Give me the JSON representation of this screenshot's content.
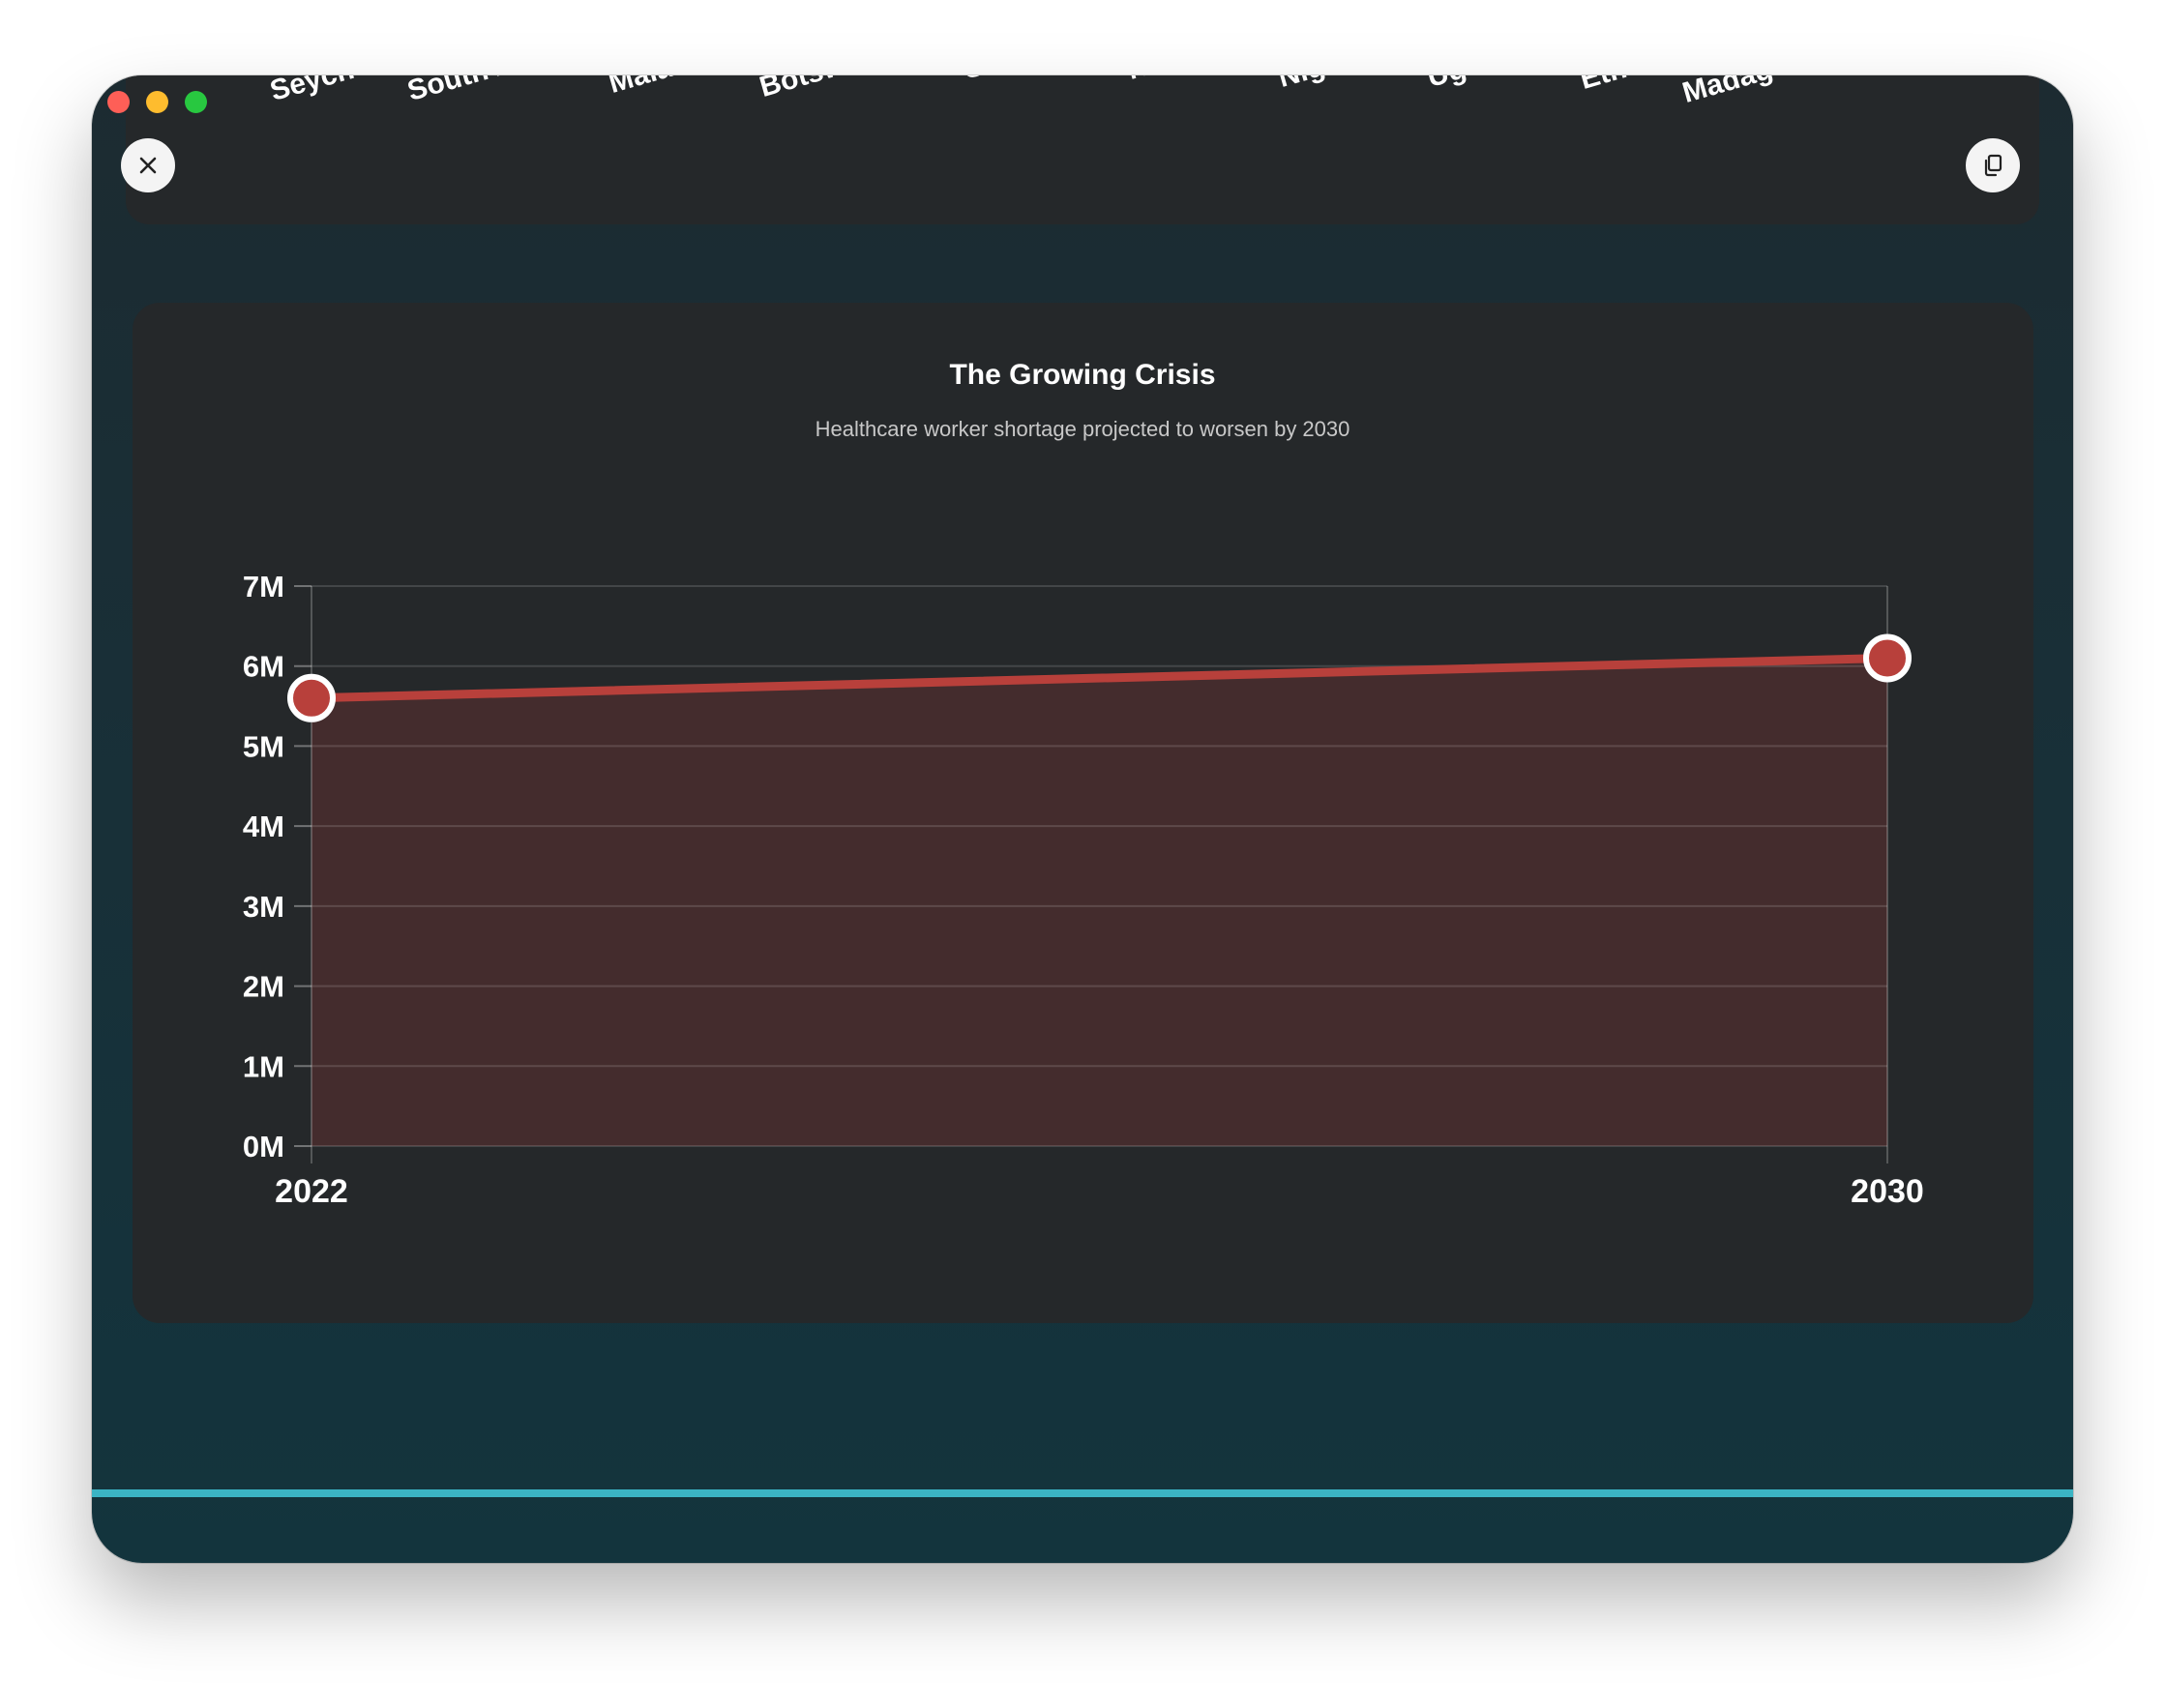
{
  "window": {
    "controls": [
      "close",
      "minimize",
      "zoom"
    ]
  },
  "top_strip": {
    "country_labels": [
      "Seych",
      "South A",
      "Mala",
      "Botsw",
      "G",
      "N",
      "Nig",
      "Ug",
      "Eth",
      "Madag"
    ],
    "close_icon": "close-icon",
    "copy_icon": "copy-icon"
  },
  "chart_data": {
    "type": "area",
    "title": "The Growing Crisis",
    "subtitle": "Healthcare worker shortage projected to worsen by 2030",
    "x": [
      "2022",
      "2030"
    ],
    "series": [
      {
        "values": [
          5.6,
          6.1
        ],
        "unit": "M"
      }
    ],
    "yticks": [
      "0M",
      "1M",
      "2M",
      "3M",
      "4M",
      "5M",
      "6M",
      "7M"
    ],
    "ylim": [
      0,
      7
    ],
    "grid": true,
    "legend": "none",
    "colors": {
      "line": "#b8403b",
      "fill": "#442c2d",
      "marker_border": "#ffffff"
    }
  },
  "colors": {
    "accent": "#3bb4c4"
  }
}
